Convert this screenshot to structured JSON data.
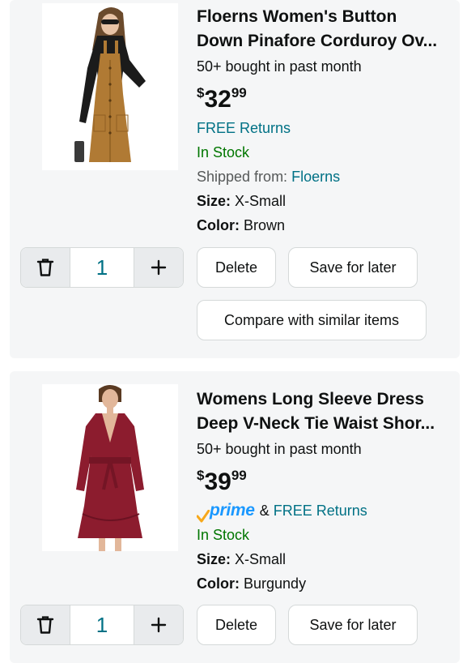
{
  "items": [
    {
      "title_line1": "Floerns Women's Button",
      "title_line2": "Down Pinafore Corduroy Ov...",
      "bought": "50+ bought in past month",
      "price": {
        "symbol": "$",
        "whole": "32",
        "fraction": "99"
      },
      "returns": "FREE Returns",
      "stock": "In Stock",
      "shipped_label": "Shipped from:",
      "shipped_from": "Floerns",
      "size_label": "Size:",
      "size": "X-Small",
      "color_label": "Color:",
      "color": "Brown",
      "quantity": "1",
      "delete_label": "Delete",
      "save_label": "Save for later",
      "compare_label": "Compare with similar items",
      "product_color": "#b07a34"
    },
    {
      "title_line1": "Womens Long Sleeve Dress",
      "title_line2": "Deep V-Neck Tie Waist Shor...",
      "bought": "50+ bought in past month",
      "price": {
        "symbol": "$",
        "whole": "39",
        "fraction": "99"
      },
      "prime_label": "prime",
      "prime_joiner": "&",
      "returns": "FREE Returns",
      "stock": "In Stock",
      "size_label": "Size:",
      "size": "X-Small",
      "color_label": "Color:",
      "color": "Burgundy",
      "quantity": "1",
      "delete_label": "Delete",
      "save_label": "Save for later",
      "product_color": "#8c1c2e"
    }
  ],
  "icons": {
    "trash": "trash-icon",
    "plus": "plus-icon",
    "prime_check": "prime-check-icon"
  },
  "colors": {
    "link": "#007185",
    "in_stock": "#007600",
    "prime_blue": "#1a98ff",
    "prime_check": "#f7a81b"
  }
}
